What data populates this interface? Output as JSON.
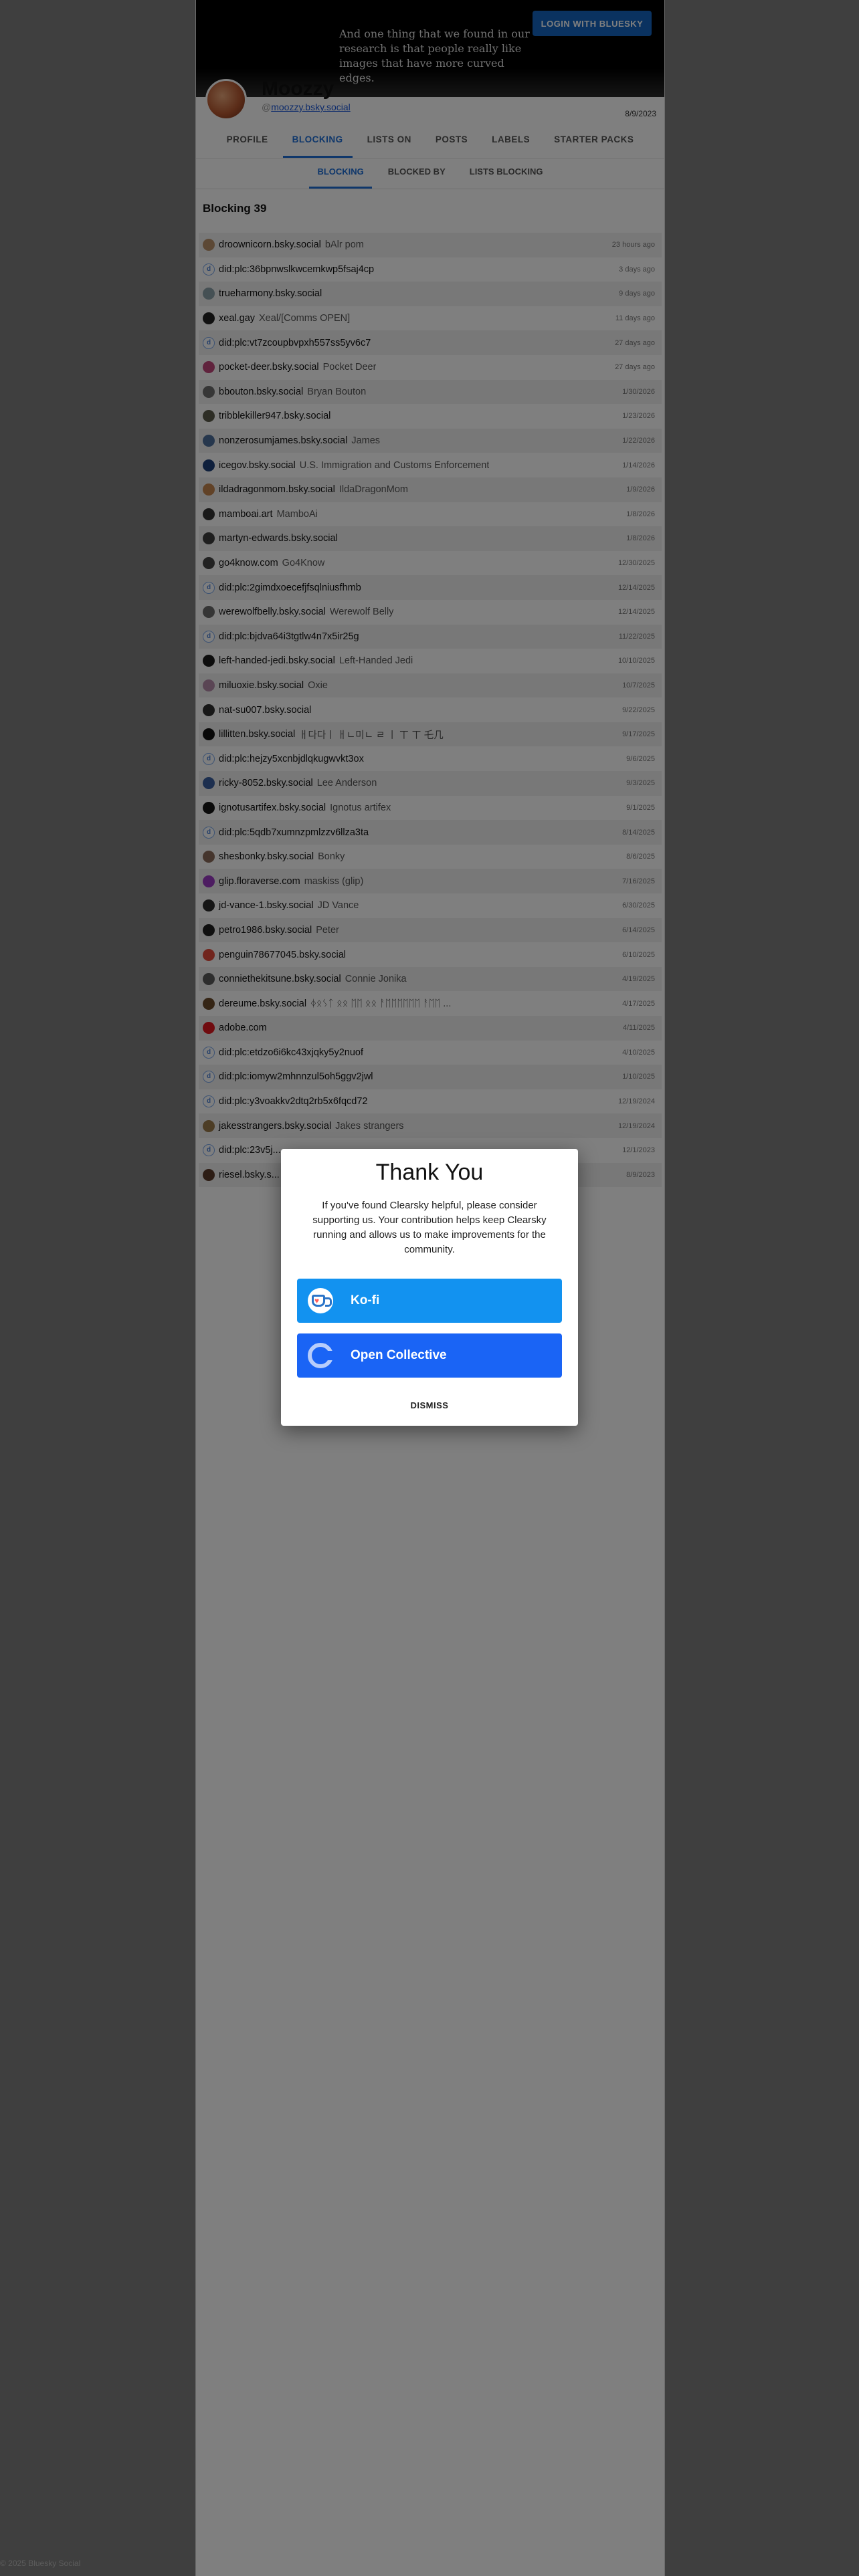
{
  "banner": {
    "text": "And one thing that we found in our research is that people really like images that have more curved edges.",
    "login_label": "LOGIN WITH BLUESKY"
  },
  "profile": {
    "name": "Moozzy",
    "handle": "moozzy.bsky.social",
    "at_symbol": "@",
    "date": "8/9/2023"
  },
  "tabs": [
    "PROFILE",
    "BLOCKING",
    "LISTS ON",
    "POSTS",
    "LABELS",
    "STARTER PACKS"
  ],
  "subtabs": [
    "BLOCKING",
    "BLOCKED BY",
    "LISTS BLOCKING"
  ],
  "list": {
    "title": "Blocking 39",
    "rows": [
      {
        "handle": "droownicorn.bsky.social",
        "name": "bAlr pom",
        "date": "23 hours ago",
        "avatar": "#b8916b"
      },
      {
        "handle": "did:plc:36bpnwslkwcemkwp5fsaj4cp",
        "name": "",
        "date": "3 days ago",
        "avatar": "did"
      },
      {
        "handle": "trueharmony.bsky.social",
        "name": "",
        "date": "9 days ago",
        "avatar": "#8aa0a8"
      },
      {
        "handle": "xeal.gay",
        "name": "Xeal/[Comms OPEN]",
        "date": "11 days ago",
        "avatar": "#222222"
      },
      {
        "handle": "did:plc:vt7zcoupbvpxh557ss5yv6c7",
        "name": "",
        "date": "27 days ago",
        "avatar": "did"
      },
      {
        "handle": "pocket-deer.bsky.social",
        "name": "Pocket Deer",
        "date": "27 days ago",
        "avatar": "#c0477a"
      },
      {
        "handle": "bbouton.bsky.social",
        "name": "Bryan Bouton",
        "date": "1/30/2026",
        "avatar": "#6d6d6d"
      },
      {
        "handle": "tribblekiller947.bsky.social",
        "name": "",
        "date": "1/23/2026",
        "avatar": "#5a5a4a"
      },
      {
        "handle": "nonzerosumjames.bsky.social",
        "name": "James",
        "date": "1/22/2026",
        "avatar": "#4d6e9a"
      },
      {
        "handle": "icegov.bsky.social",
        "name": "U.S. Immigration and Customs Enforcement",
        "date": "1/14/2026",
        "avatar": "#1c3f78"
      },
      {
        "handle": "ildadragonmom.bsky.social",
        "name": "IldaDragonMom",
        "date": "1/9/2026",
        "avatar": "#c2844e"
      },
      {
        "handle": "mamboai.art",
        "name": "MamboAi",
        "date": "1/8/2026",
        "avatar": "#333333"
      },
      {
        "handle": "martyn-edwards.bsky.social",
        "name": "",
        "date": "1/8/2026",
        "avatar": "#3d3d3d"
      },
      {
        "handle": "go4know.com",
        "name": "Go4Know",
        "date": "12/30/2025",
        "avatar": "#444444"
      },
      {
        "handle": "did:plc:2gimdxoecefjfsqlniusfhmb",
        "name": "",
        "date": "12/14/2025",
        "avatar": "did"
      },
      {
        "handle": "werewolfbelly.bsky.social",
        "name": "Werewolf Belly",
        "date": "12/14/2025",
        "avatar": "#6a6a6a"
      },
      {
        "handle": "did:plc:bjdva64i3tgtlw4n7x5ir25g",
        "name": "",
        "date": "11/22/2025",
        "avatar": "did"
      },
      {
        "handle": "left-handed-jedi.bsky.social",
        "name": "Left-Handed Jedi",
        "date": "10/10/2025",
        "avatar": "#1a1a1a"
      },
      {
        "handle": "miluoxie.bsky.social",
        "name": "Oxie",
        "date": "10/7/2025",
        "avatar": "#b48aa8"
      },
      {
        "handle": "nat-su007.bsky.social",
        "name": "",
        "date": "9/22/2025",
        "avatar": "#2e2e2e"
      },
      {
        "handle": "lillitten.bsky.social",
        "name": "ㅐ다다ㅣ ㅐㄴ미ㄴ ㄹ ㅣ ㄒ ㄒ 乇几",
        "date": "9/17/2025",
        "avatar": "#111111"
      },
      {
        "handle": "did:plc:hejzy5xcnbjdlqkugwvkt3ox",
        "name": "",
        "date": "9/6/2025",
        "avatar": "did"
      },
      {
        "handle": "ricky-8052.bsky.social",
        "name": "Lee Anderson",
        "date": "9/3/2025",
        "avatar": "#3a5f9e"
      },
      {
        "handle": "ignotusartifex.bsky.social",
        "name": "Ignotus artifex",
        "date": "9/1/2025",
        "avatar": "#151515"
      },
      {
        "handle": "did:plc:5qdb7xumnzpmlzzv6llza3ta",
        "name": "",
        "date": "8/14/2025",
        "avatar": "did"
      },
      {
        "handle": "shesbonky.bsky.social",
        "name": "Bonky",
        "date": "8/6/2025",
        "avatar": "#8a6b5a"
      },
      {
        "handle": "glip.floraverse.com",
        "name": "maskiss (glip)",
        "date": "7/16/2025",
        "avatar": "#9b3bc2"
      },
      {
        "handle": "jd-vance-1.bsky.social",
        "name": "JD Vance",
        "date": "6/30/2025",
        "avatar": "#2a2a2a"
      },
      {
        "handle": "petro1986.bsky.social",
        "name": "Peter",
        "date": "6/14/2025",
        "avatar": "#1e1e1e"
      },
      {
        "handle": "penguin78677045.bsky.social",
        "name": "",
        "date": "6/10/2025",
        "avatar": "#e24a3a"
      },
      {
        "handle": "conniethekitsune.bsky.social",
        "name": "Connie Jonika",
        "date": "4/19/2025",
        "avatar": "#5a5a5a"
      },
      {
        "handle": "dereume.bsky.social",
        "name": "ᛄᛟᛊᛏ ᛟᛟ ᛖᛖ ᛟᛟ ᚨᛖᛖᛖᛖᛖᛖ ᚨᛖᛖ ...",
        "date": "4/17/2025",
        "avatar": "#6b4a2a"
      },
      {
        "handle": "adobe.com",
        "name": "",
        "date": "4/11/2025",
        "avatar": "#e0161e"
      },
      {
        "handle": "did:plc:etdzo6i6kc43xjqky5y2nuof",
        "name": "",
        "date": "4/10/2025",
        "avatar": "did"
      },
      {
        "handle": "did:plc:iomyw2mhnnzul5oh5ggv2jwl",
        "name": "",
        "date": "1/10/2025",
        "avatar": "did"
      },
      {
        "handle": "did:plc:y3voakkv2dtq2rb5x6fqcd72",
        "name": "",
        "date": "12/19/2024",
        "avatar": "did"
      },
      {
        "handle": "jakesstrangers.bsky.social",
        "name": "Jakes strangers",
        "date": "12/19/2024",
        "avatar": "#9a7a4a"
      },
      {
        "handle": "did:plc:23v5j...",
        "name": "",
        "date": "12/1/2023",
        "avatar": "did"
      },
      {
        "handle": "riesel.bsky.s...",
        "name": "",
        "date": "8/9/2023",
        "avatar": "#5a3a2a"
      }
    ]
  },
  "footer": "© 2025 Bluesky Social",
  "modal": {
    "title": "Thank You",
    "body": "If you've found Clearsky helpful, please consider supporting us. Your contribution helps keep Clearsky running and allows us to make improvements for the community.",
    "kofi_label": "Ko-fi",
    "oc_label": "Open Collective",
    "dismiss_label": "DISMISS"
  },
  "colors": {
    "accent": "#1e6fd6",
    "kofi": "#1292f0",
    "open_collective": "#1a64f5"
  }
}
